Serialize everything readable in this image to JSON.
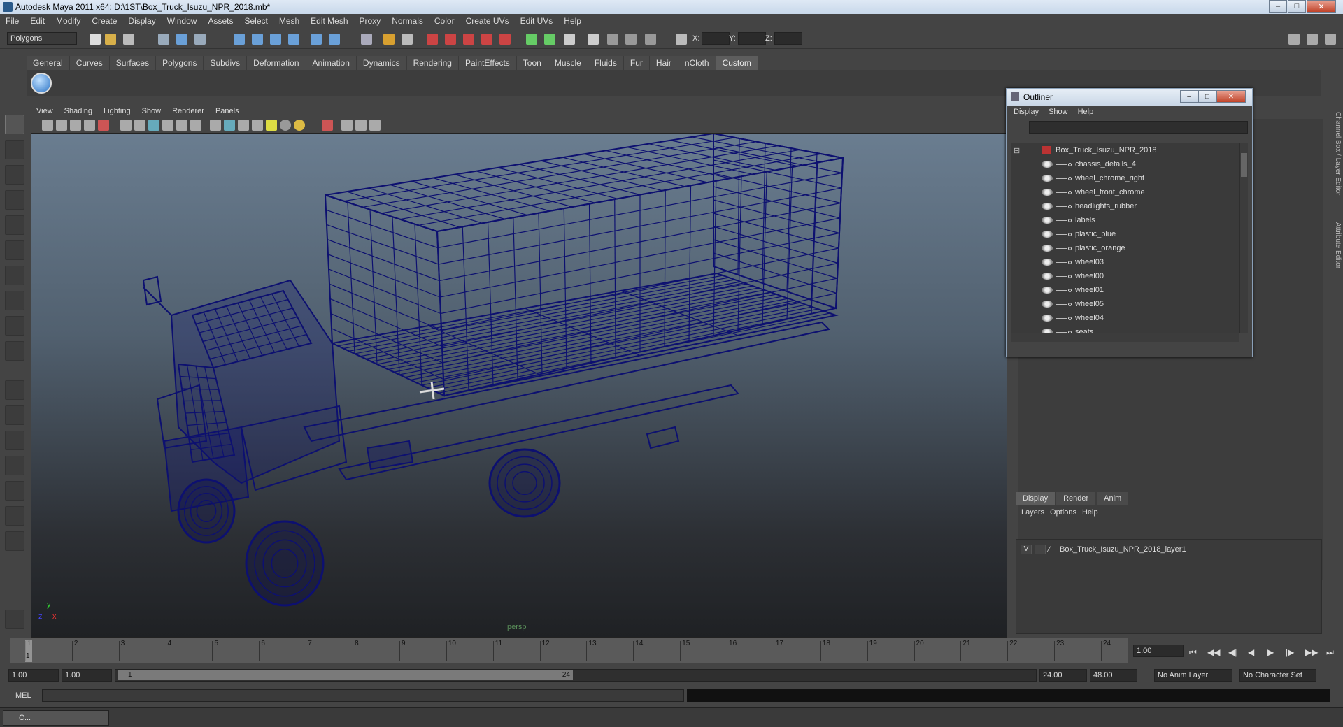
{
  "window": {
    "title": "Autodesk Maya 2011 x64: D:\\1ST\\Box_Truck_Isuzu_NPR_2018.mb*"
  },
  "menubar": [
    "File",
    "Edit",
    "Modify",
    "Create",
    "Display",
    "Window",
    "Assets",
    "Select",
    "Mesh",
    "Edit Mesh",
    "Proxy",
    "Normals",
    "Color",
    "Create UVs",
    "Edit UVs",
    "Help"
  ],
  "statusline": {
    "mode": "Polygons",
    "x_label": "X:",
    "y_label": "Y:",
    "z_label": "Z:"
  },
  "shelf": {
    "tabs": [
      "General",
      "Curves",
      "Surfaces",
      "Polygons",
      "Subdivs",
      "Deformation",
      "Animation",
      "Dynamics",
      "Rendering",
      "PaintEffects",
      "Toon",
      "Muscle",
      "Fluids",
      "Fur",
      "Hair",
      "nCloth",
      "Custom"
    ],
    "active_tab": "Custom"
  },
  "viewport": {
    "menus": [
      "View",
      "Shading",
      "Lighting",
      "Show",
      "Renderer",
      "Panels"
    ],
    "camera_label": "persp",
    "axis_x": "x",
    "axis_y": "y",
    "axis_z": "z",
    "wire_color": "#0d1070"
  },
  "outliner": {
    "title": "Outliner",
    "menus": [
      "Display",
      "Show",
      "Help"
    ],
    "root": "Box_Truck_Isuzu_NPR_2018",
    "items": [
      "chassis_details_4",
      "wheel_chrome_right",
      "wheel_front_chrome",
      "headlights_rubber",
      "labels",
      "plastic_blue",
      "plastic_orange",
      "wheel03",
      "wheel00",
      "wheel01",
      "wheel05",
      "wheel04",
      "seats"
    ]
  },
  "side_tabs": [
    "Channel Box / Layer Editor",
    "Attribute Editor"
  ],
  "layer_editor": {
    "tabs": [
      "Display",
      "Render",
      "Anim"
    ],
    "active_tab": "Display",
    "menus": [
      "Layers",
      "Options",
      "Help"
    ],
    "layers": [
      {
        "visible": "V",
        "name": "Box_Truck_Isuzu_NPR_2018_layer1"
      }
    ]
  },
  "timeline": {
    "ticks": [
      "1",
      "2",
      "3",
      "4",
      "5",
      "6",
      "7",
      "8",
      "9",
      "10",
      "11",
      "12",
      "13",
      "14",
      "15",
      "16",
      "17",
      "18",
      "19",
      "20",
      "21",
      "22",
      "23",
      "24"
    ],
    "current_frame": "1.00",
    "current_marker": "1"
  },
  "range": {
    "start": "1.00",
    "playback_start": "1.00",
    "slider_start": "1",
    "slider_end": "24",
    "playback_end": "24.00",
    "end": "48.00",
    "anim_layer": "No Anim Layer",
    "character_set": "No Character Set"
  },
  "command_line": {
    "label": "MEL"
  },
  "taskbar": {
    "item": "C..."
  }
}
